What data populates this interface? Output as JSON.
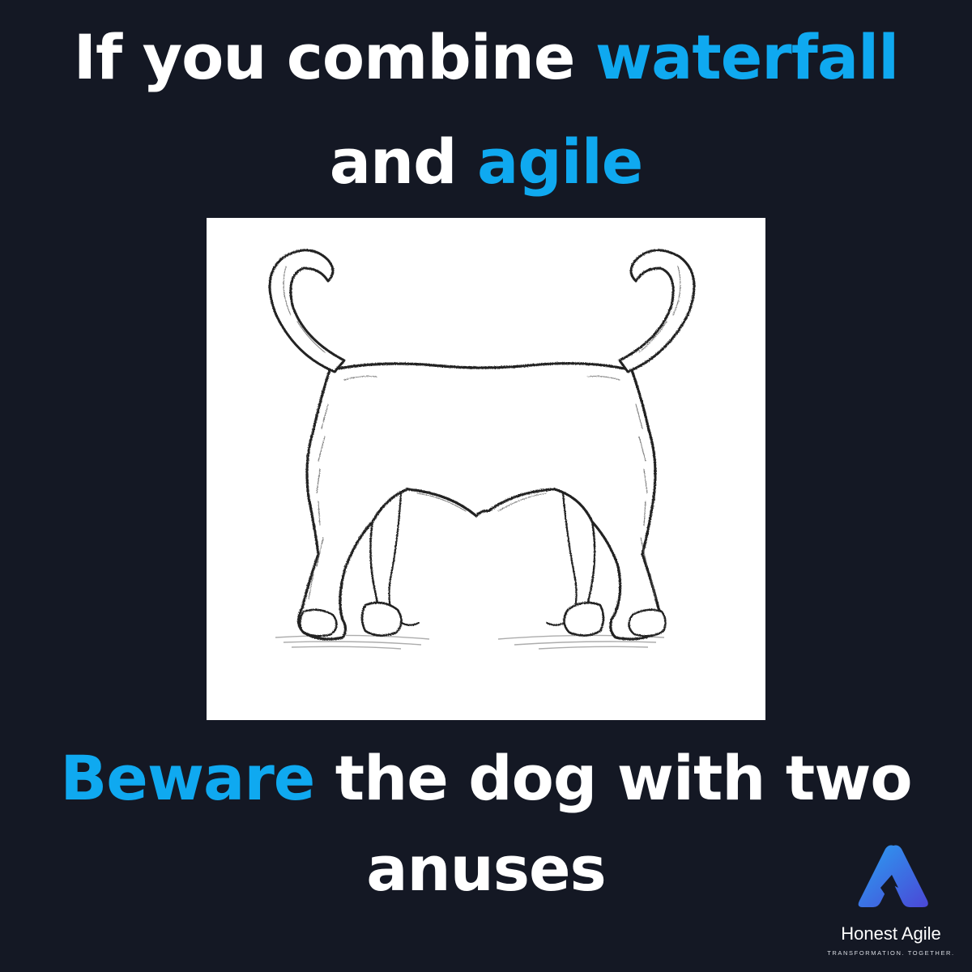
{
  "headline": {
    "line1": {
      "text": "If you combine ",
      "accent": "waterfall"
    },
    "line2": {
      "text": "and ",
      "accent": "agile"
    },
    "line3": {
      "accent": "Beware",
      "text": " the dog with two"
    },
    "line4": {
      "text": "anuses"
    }
  },
  "illustration": {
    "subject": "pencil sketch of a dog with a tail at each end and no head"
  },
  "logo": {
    "name": "Honest Agile",
    "tagline": "TRANSFORMATION. TOGETHER.",
    "icon": "stylized-a-arrow-icon"
  },
  "colors": {
    "background": "#141824",
    "text": "#ffffff",
    "accent": "#0fa9f0",
    "logo_gradient": [
      "#2aa0f2",
      "#4b47d6"
    ]
  }
}
